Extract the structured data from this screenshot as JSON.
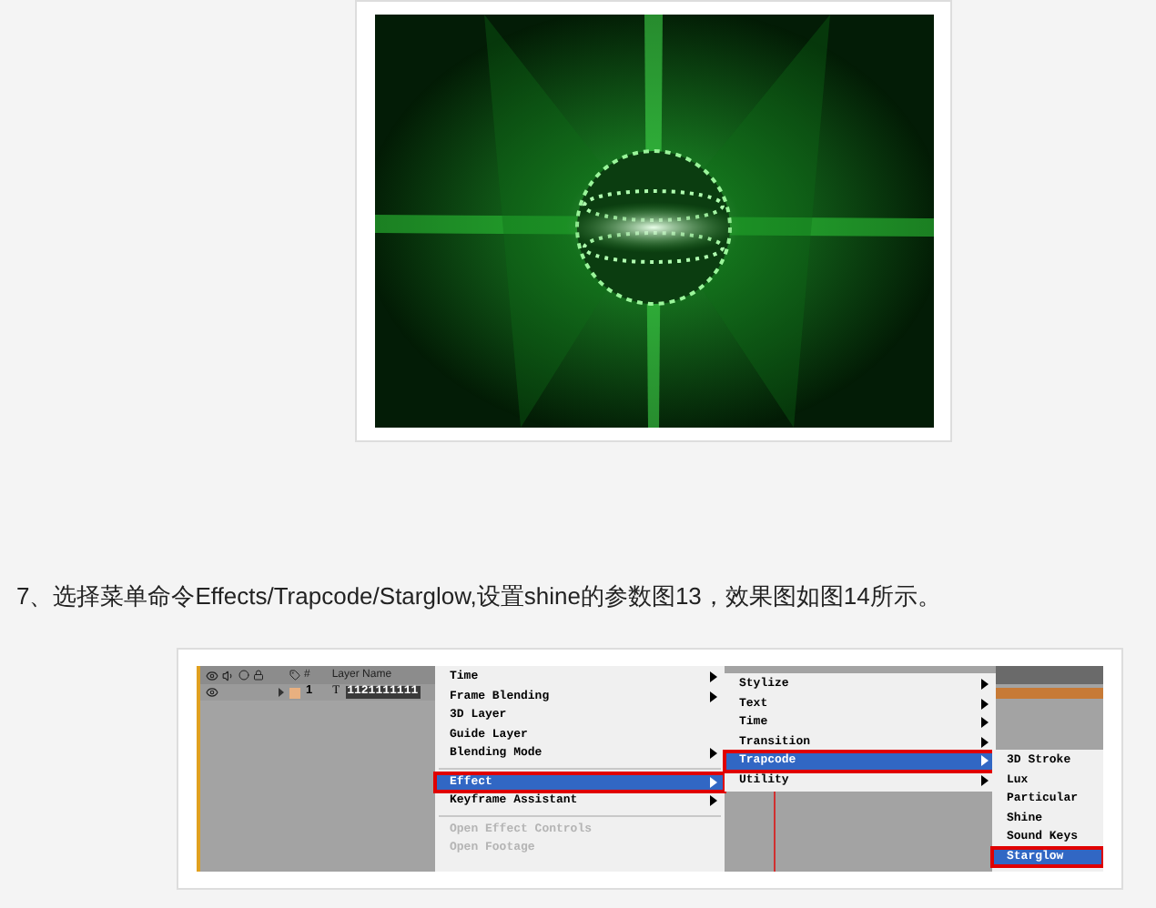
{
  "caption": "7、选择菜单命令Effects/Trapcode/Starglow,设置shine的参数图13，效果图如图14所示。",
  "screenshot": {
    "timeline": {
      "number_header": "#",
      "name_header": "Layer Name",
      "layer": {
        "number": "1",
        "type": "T",
        "name": "1121111111",
        "color": "#e8b080"
      }
    },
    "layer_menu": [
      {
        "kind": "item",
        "label": "Time",
        "submenu": true,
        "selected": false,
        "disabled": false
      },
      {
        "kind": "item",
        "label": "Frame Blending",
        "submenu": true,
        "selected": false,
        "disabled": false
      },
      {
        "kind": "item",
        "label": "3D Layer",
        "submenu": false,
        "selected": false,
        "disabled": false
      },
      {
        "kind": "item",
        "label": "Guide Layer",
        "submenu": false,
        "selected": false,
        "disabled": false
      },
      {
        "kind": "item",
        "label": "Blending Mode",
        "submenu": true,
        "selected": false,
        "disabled": false
      },
      {
        "kind": "separator"
      },
      {
        "kind": "item",
        "label": "Effect",
        "submenu": true,
        "selected": true,
        "disabled": false
      },
      {
        "kind": "item",
        "label": "Keyframe Assistant",
        "submenu": true,
        "selected": false,
        "disabled": false
      },
      {
        "kind": "separator"
      },
      {
        "kind": "item",
        "label": "Open Effect Controls",
        "submenu": false,
        "selected": false,
        "disabled": true
      },
      {
        "kind": "item",
        "label": "Open Footage",
        "submenu": false,
        "selected": false,
        "disabled": true
      }
    ],
    "effect_menu": [
      {
        "kind": "item",
        "label": "Stylize",
        "submenu": true,
        "selected": false,
        "disabled": false
      },
      {
        "kind": "item",
        "label": "Text",
        "submenu": true,
        "selected": false,
        "disabled": false
      },
      {
        "kind": "item",
        "label": "Time",
        "submenu": true,
        "selected": false,
        "disabled": false
      },
      {
        "kind": "item",
        "label": "Transition",
        "submenu": true,
        "selected": false,
        "disabled": false
      },
      {
        "kind": "item",
        "label": "Trapcode",
        "submenu": true,
        "selected": true,
        "disabled": false
      },
      {
        "kind": "item",
        "label": "Utility",
        "submenu": true,
        "selected": false,
        "disabled": false
      }
    ],
    "trapcode_menu": [
      {
        "kind": "item",
        "label": "3D Stroke",
        "submenu": false,
        "selected": false,
        "disabled": false
      },
      {
        "kind": "item",
        "label": "Lux",
        "submenu": false,
        "selected": false,
        "disabled": false
      },
      {
        "kind": "item",
        "label": "Particular",
        "submenu": false,
        "selected": false,
        "disabled": false
      },
      {
        "kind": "item",
        "label": "Shine",
        "submenu": false,
        "selected": false,
        "disabled": false
      },
      {
        "kind": "item",
        "label": "Sound Keys",
        "submenu": false,
        "selected": false,
        "disabled": false
      },
      {
        "kind": "item",
        "label": "Starglow",
        "submenu": false,
        "selected": true,
        "disabled": false
      }
    ]
  }
}
